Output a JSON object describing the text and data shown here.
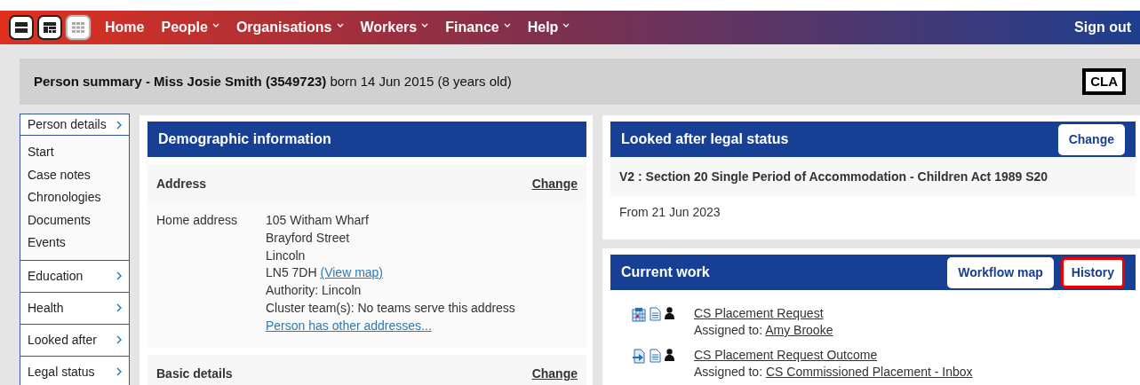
{
  "layout_switcher": [
    {
      "kind": "rows",
      "disabled": false
    },
    {
      "kind": "panels",
      "disabled": false
    },
    {
      "kind": "grid",
      "disabled": true
    }
  ],
  "nav": [
    {
      "label": "Home",
      "dropdown": false
    },
    {
      "label": "People",
      "dropdown": true
    },
    {
      "label": "Organisations",
      "dropdown": true
    },
    {
      "label": "Workers",
      "dropdown": true
    },
    {
      "label": "Finance",
      "dropdown": true
    },
    {
      "label": "Help",
      "dropdown": true
    }
  ],
  "sign_out": "Sign out",
  "summary": {
    "text": "**Person summary - Miss Josie Smith (3549723)** born 14 Jun 2015 (8 years old)",
    "badge": "CLA"
  },
  "sidebar": [
    {
      "label": "Person details",
      "children": [
        {
          "label": "Start"
        },
        {
          "label": "Case notes"
        },
        {
          "label": "Chronologies"
        },
        {
          "label": "Documents"
        },
        {
          "label": "Events"
        }
      ]
    },
    {
      "label": "Education"
    },
    {
      "label": "Health"
    },
    {
      "label": "Looked after"
    },
    {
      "label": "Legal status"
    }
  ],
  "demographic": {
    "title": "Demographic information",
    "sections": [
      {
        "title": "Address",
        "action": "Change",
        "rows": [
          {
            "label": "Home address",
            "lines": [
              "105 Witham Wharf",
              "Brayford Street",
              "Lincoln"
            ],
            "postcode": "LN5 7DH",
            "map_link": "(View map)",
            "more_lines": [
              "Authority: Lincoln",
              "Cluster team(s): No teams serve this address"
            ],
            "other_link": "Person has other addresses..."
          }
        ]
      },
      {
        "title": "Basic details",
        "action": "Change"
      }
    ]
  },
  "legal_status": {
    "title": "Looked after legal status",
    "action": "Change",
    "status": "V2 : Section 20 Single Period of Accommodation - Children Act 1989 S20",
    "from": "From 21 Jun 2023"
  },
  "current_work": {
    "title": "Current work",
    "buttons": [
      {
        "label": "Workflow map",
        "highlighted": false
      },
      {
        "label": "History",
        "highlighted": true
      }
    ],
    "items": [
      {
        "kind": "form",
        "title": "CS Placement Request",
        "assigned_label": "Assigned to:",
        "assignee": "Amy Brooke"
      },
      {
        "kind": "outcome",
        "title": "CS Placement Request Outcome",
        "assigned_label": "Assigned to:",
        "assignee": "CS Commissioned Placement - Inbox"
      }
    ]
  }
}
